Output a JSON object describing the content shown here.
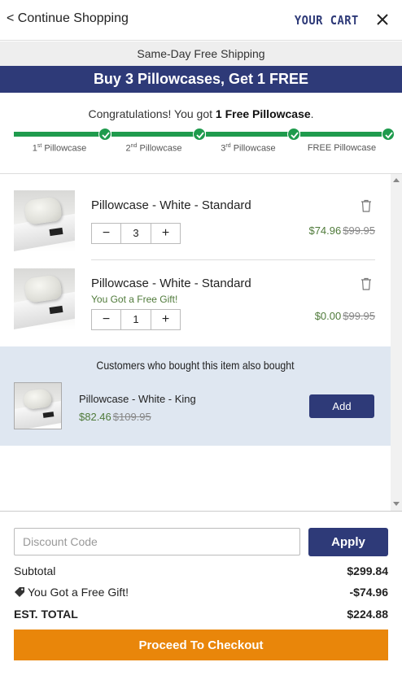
{
  "header": {
    "continue_label": "< Continue Shopping",
    "cart_title": "YOUR CART",
    "close_icon": "close-icon"
  },
  "shipping_banner": "Same-Day Free Shipping",
  "promo_banner": "Buy 3 Pillowcases, Get 1 FREE",
  "progress": {
    "congrats_prefix": "Congratulations! You got ",
    "congrats_bold": "1 Free Pillowcase",
    "congrats_suffix": ".",
    "steps": [
      {
        "num": "1",
        "sup": "st",
        "label": " Pillowcase"
      },
      {
        "num": "2",
        "sup": "nd",
        "label": " Pillowcase"
      },
      {
        "num": "3",
        "sup": "rd",
        "label": " Pillowcase"
      },
      {
        "num": "",
        "sup": "",
        "label": "FREE Pillowcase"
      }
    ],
    "completed_steps": 4,
    "color": "#1f9b4d"
  },
  "items": [
    {
      "name": "Pillowcase - White - Standard",
      "gift_note": "",
      "quantity": "3",
      "sale_price": "$74.96",
      "original_price": "$99.95"
    },
    {
      "name": "Pillowcase - White - Standard",
      "gift_note": "You Got a Free Gift!",
      "quantity": "1",
      "sale_price": "$0.00",
      "original_price": "$99.95"
    }
  ],
  "qty_minus": "−",
  "qty_plus": "+",
  "upsell": {
    "title": "Customers who bought this item also bought",
    "name": "Pillowcase - White - King",
    "sale_price": "$82.46",
    "original_price": "$109.95",
    "add_label": "Add"
  },
  "discount": {
    "placeholder": "Discount Code",
    "apply_label": "Apply"
  },
  "summary": {
    "subtotal_label": "Subtotal",
    "subtotal_value": "$299.84",
    "gift_label": "You Got a Free Gift!",
    "gift_value": "-$74.96",
    "total_label": "EST. TOTAL",
    "total_value": "$224.88"
  },
  "checkout_label": "Proceed To Checkout",
  "colors": {
    "brand_navy": "#2e3a78",
    "progress_green": "#1f9b4d",
    "price_green": "#4f7a3a",
    "checkout_orange": "#e9860a"
  }
}
